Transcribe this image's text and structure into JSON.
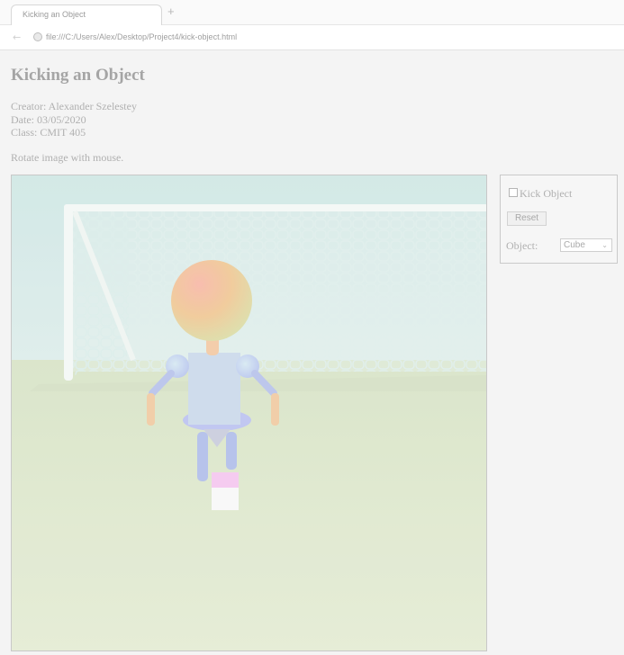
{
  "browser": {
    "tab_title": "Kicking an Object",
    "new_tab": "+",
    "back": "←",
    "url": "file:///C:/Users/Alex/Desktop/Project4/kick-object.html"
  },
  "page": {
    "title": "Kicking an Object",
    "creator": "Creator: Alexander Szelestey",
    "date": "Date: 03/05/2020",
    "class": "Class: CMIT 405",
    "instruction": "Rotate image with mouse."
  },
  "controls": {
    "kick_label": "Kick Object",
    "kick_checked": false,
    "reset_label": "Reset",
    "object_label": "Object:",
    "object_value": "Cube"
  },
  "icons": {
    "back": "back-arrow-icon",
    "page": "file-icon",
    "select": "chevron-down-icon"
  },
  "colors": {
    "sky": "#cfe5e2",
    "grass": "#dfe8cc",
    "head": "#f0c48e",
    "body": "#c9d9ec",
    "limbs": "#a9b6ef",
    "ball_top": "#f4c4ee",
    "ball_bottom": "#f7f7f7"
  }
}
